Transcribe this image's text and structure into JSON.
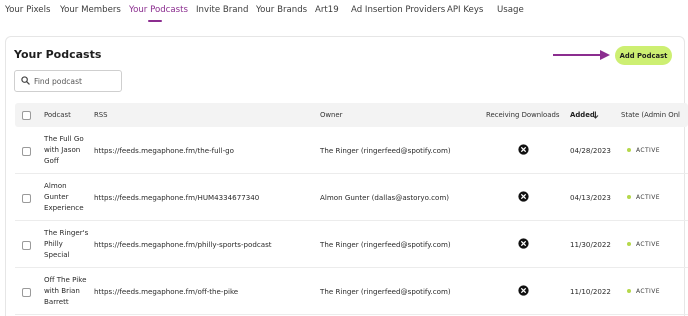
{
  "nav": {
    "tabs": [
      {
        "label": "Your Pixels"
      },
      {
        "label": "Your Members"
      },
      {
        "label": "Your Podcasts",
        "active": true
      },
      {
        "label": "Invite Brand"
      },
      {
        "label": "Your Brands"
      },
      {
        "label": "Art19"
      },
      {
        "label": "Ad Insertion Providers"
      },
      {
        "label": "API Keys"
      },
      {
        "label": "Usage"
      }
    ]
  },
  "page": {
    "title": "Your Podcasts",
    "add_button_label": "Add Podcast"
  },
  "search": {
    "placeholder": "Find podcast",
    "value": ""
  },
  "table": {
    "columns": {
      "podcast": "Podcast",
      "rss": "RSS",
      "owner": "Owner",
      "receiving_downloads": "Receiving Downloads",
      "added": "Added",
      "state": "State (Admin Onl"
    },
    "sort": {
      "column": "Added",
      "direction": "descending"
    },
    "rows": [
      {
        "podcast_lines": [
          "The Full Go",
          "with Jason",
          "Goff"
        ],
        "rss": "https://feeds.megaphone.fm/the-full-go",
        "owner": "The Ringer (ringerfeed@spotify.com)",
        "receiving_downloads": false,
        "added": "04/28/2023",
        "state": "ACTIVE"
      },
      {
        "podcast_lines": [
          "Almon",
          "Gunter",
          "Experience"
        ],
        "rss": "https://feeds.megaphone.fm/HUM4334677340",
        "owner": "Almon Gunter (dallas@astoryo.com)",
        "receiving_downloads": false,
        "added": "04/13/2023",
        "state": "ACTIVE"
      },
      {
        "podcast_lines": [
          "The Ringer's",
          "Philly",
          "Special"
        ],
        "rss": "https://feeds.megaphone.fm/philly-sports-podcast",
        "owner": "The Ringer (ringerfeed@spotify.com)",
        "receiving_downloads": false,
        "added": "11/30/2022",
        "state": "ACTIVE"
      },
      {
        "podcast_lines": [
          "Off The Pike",
          "with Brian",
          "Barrett"
        ],
        "rss": "https://feeds.megaphone.fm/off-the-pike",
        "owner": "The Ringer (ringerfeed@spotify.com)",
        "receiving_downloads": false,
        "added": "11/10/2022",
        "state": "ACTIVE"
      }
    ]
  },
  "colors": {
    "accent": "#8b2d8f",
    "button": "#cdef72",
    "active_dot": "#b5d84b"
  },
  "icons": {
    "search": "search-icon",
    "sort": "arrow-down-icon",
    "not_receiving": "x-circle-icon",
    "pointer": "arrow-right-icon"
  }
}
